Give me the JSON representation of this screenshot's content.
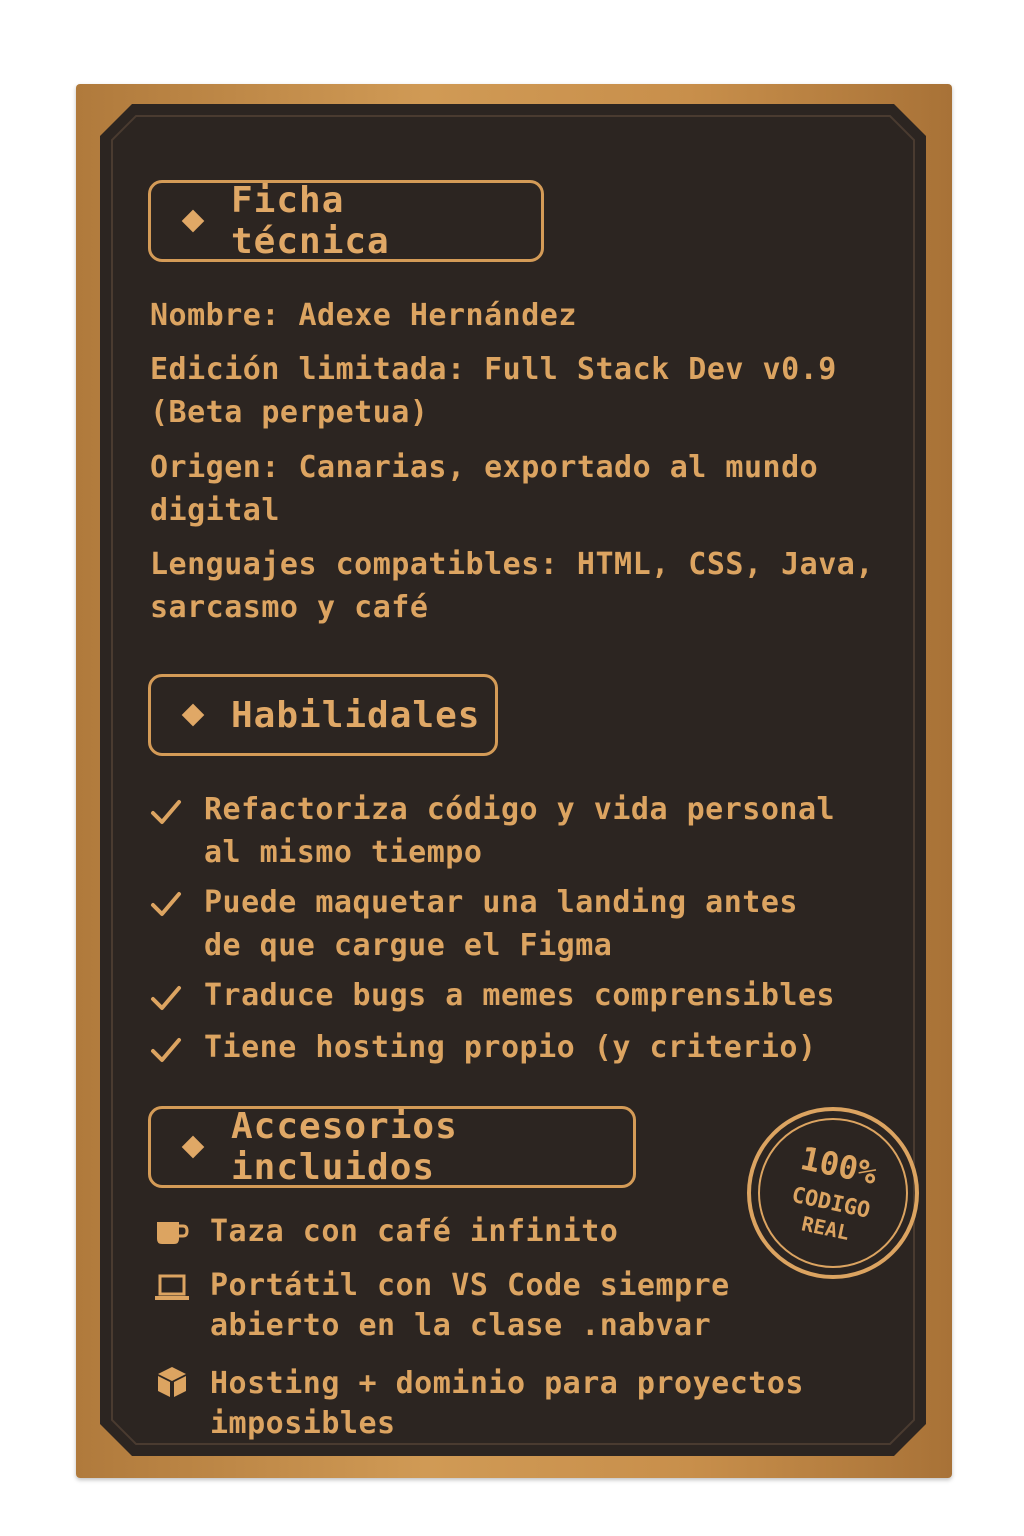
{
  "ficha": {
    "title": "Ficha técnica",
    "nombre": "Nombre: Adexe Hernández",
    "edicion": "Edición limitada: Full Stack Dev v0.9\n(Beta perpetua)",
    "origen": "Origen: Canarias, exportado al mundo\ndigital",
    "lenguajes": "Lenguajes compatibles: HTML, CSS, Java,\nsarcasmo y café"
  },
  "habilidades": {
    "title": "Habilidales",
    "items": [
      "Refactoriza código y vida personal\nal mismo tiempo",
      "Puede maquetar una landing antes\nde que cargue el Figma",
      "Traduce bugs a memes comprensibles",
      "Tiene hosting propio (y criterio)"
    ]
  },
  "accesorios": {
    "title": "Accesorios incluidos",
    "items": [
      {
        "icon": "mug-icon",
        "text": "Taza con café infinito"
      },
      {
        "icon": "laptop-icon",
        "text": "Portátil con VS Code siempre\nabierto en la clase .nabvar"
      },
      {
        "icon": "box-icon",
        "text": "Hosting + dominio para proyectos\nimposibles"
      }
    ]
  },
  "stamp": {
    "top": "100%",
    "middle": "CODIGO",
    "bottom": "REAL"
  },
  "colors": {
    "accent": "#dca461",
    "panel": "#2c2521",
    "frame": "#c88f4b"
  }
}
